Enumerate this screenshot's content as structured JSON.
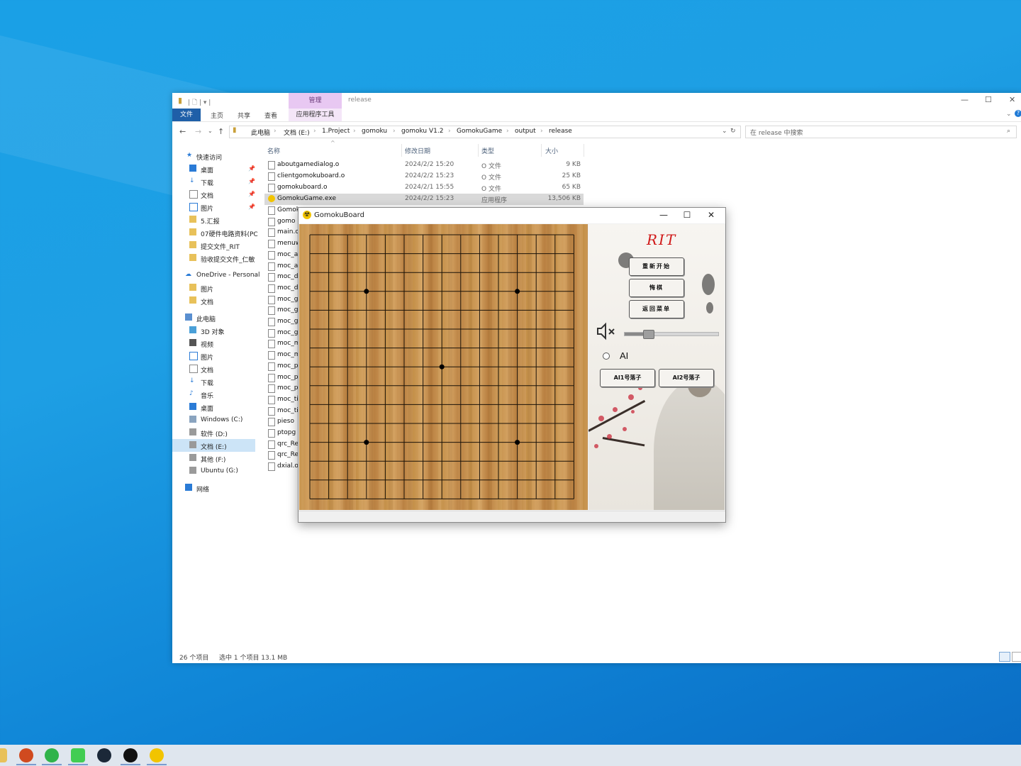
{
  "explorer": {
    "quick_access": "| 🗋 | ▾ |",
    "context_tab_header": "管理",
    "window_title": "release",
    "ribbon_tabs": [
      "文件",
      "主页",
      "共享",
      "查看"
    ],
    "ribbon_context_tab": "应用程序工具",
    "breadcrumbs": [
      "此电脑",
      "文档 (E:)",
      "1.Project",
      "gomoku",
      "gomoku V1.2",
      "GomokuGame",
      "output",
      "release"
    ],
    "search_placeholder": "在 release 中搜索",
    "columns": [
      "名称",
      "修改日期",
      "类型",
      "大小"
    ],
    "nav": {
      "quick_access": "快速访问",
      "items": [
        "桌面",
        "下载",
        "文档",
        "图片",
        "5.汇报",
        "07硬件电路资料(PC",
        "提交文件_RIT",
        "验收提交文件_仁敏"
      ],
      "onedrive": "OneDrive - Personal",
      "onedrive_items": [
        "图片",
        "文档"
      ],
      "this_pc": "此电脑",
      "pc_items": [
        "3D 对象",
        "视频",
        "图片",
        "文档",
        "下载",
        "音乐",
        "桌面",
        "Windows (C:)",
        "软件 (D:)",
        "文档 (E:)",
        "其他 (F:)",
        "Ubuntu (G:)"
      ],
      "network": "网络"
    },
    "files": [
      {
        "name": "aboutgamedialog.o",
        "date": "2024/2/2 15:20",
        "type": "O 文件",
        "size": "9 KB"
      },
      {
        "name": "clientgomokuboard.o",
        "date": "2024/2/2 15:23",
        "type": "O 文件",
        "size": "25 KB"
      },
      {
        "name": "gomokuboard.o",
        "date": "2024/2/1 15:55",
        "type": "O 文件",
        "size": "65 KB"
      },
      {
        "name": "GomokuGame.exe",
        "date": "2024/2/2 15:23",
        "type": "应用程序",
        "size": "13,506 KB"
      }
    ],
    "hidden_rows": [
      "Gomok",
      "gomo",
      "main.o",
      "menuw",
      "moc_a",
      "moc_a",
      "moc_d",
      "moc_d",
      "moc_g",
      "moc_g",
      "moc_g",
      "moc_g",
      "moc_m",
      "moc_m",
      "moc_p",
      "moc_p",
      "moc_p",
      "moc_ti",
      "moc_ti",
      "pieso",
      "ptopg",
      "qrc_Re",
      "qrc_Re",
      "dxial.o"
    ],
    "status_count": "26 个项目",
    "status_selected": "选中 1 个项目  13.1 MB"
  },
  "game": {
    "title": "GomokuBoard",
    "minimize": "—",
    "maximize": "☐",
    "close": "✕",
    "logo_text": "RIT",
    "buttons": [
      "重新开始",
      "悔棋",
      "返回菜单"
    ],
    "ai_label": "AI",
    "ai_buttons": [
      "AI1号落子",
      "AI2号落子"
    ],
    "volume_level": 0.25,
    "board_size": 15,
    "star_points": [
      [
        3,
        3
      ],
      [
        11,
        3
      ],
      [
        7,
        7
      ],
      [
        3,
        11
      ],
      [
        11,
        11
      ]
    ]
  },
  "taskbar": {
    "apps": [
      "powerpoint",
      "wechat",
      "qt-creator",
      "steam",
      "github",
      "gomoku-game"
    ]
  }
}
